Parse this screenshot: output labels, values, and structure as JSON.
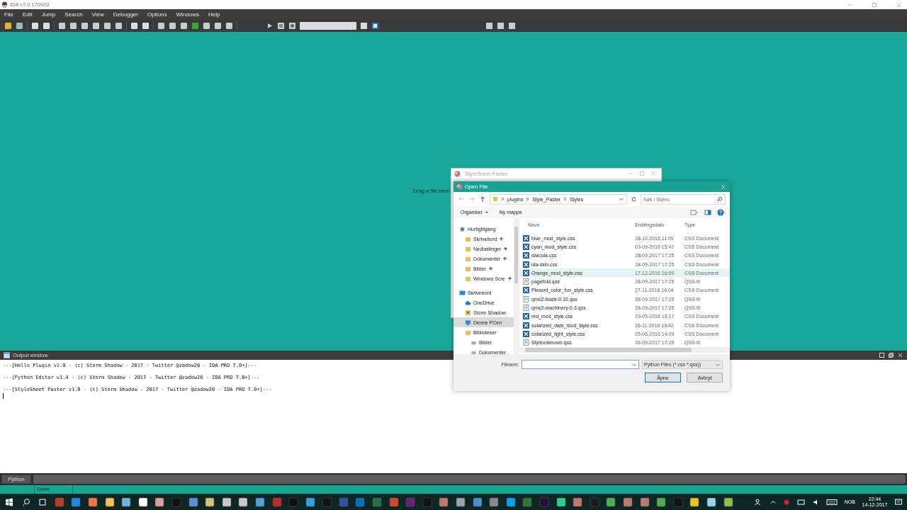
{
  "window": {
    "title": "IDA v7.0.170920"
  },
  "menu": [
    "File",
    "Edit",
    "Jump",
    "Search",
    "View",
    "Debugger",
    "Options",
    "Windows",
    "Help"
  ],
  "canvas": {
    "drop_hint": "Drag a file here"
  },
  "paster_window": {
    "title": "StyleSheet Paster"
  },
  "open_dialog": {
    "title": "Open File",
    "path": [
      "plugins",
      "Style_Paster",
      "Styles"
    ],
    "search": {
      "placeholder": "Søk i Styles"
    },
    "commands": [
      "Organiser",
      "Ny mappe"
    ],
    "nav": [
      {
        "label": "Hurtigtilgang",
        "kind": "star",
        "selected": false,
        "children": [
          {
            "label": "Skrivebord",
            "kind": "folder",
            "pinned": true,
            "selected": false
          },
          {
            "label": "Nedlastinger",
            "kind": "folder",
            "pinned": true,
            "selected": false
          },
          {
            "label": "Dokumenter",
            "kind": "folder",
            "pinned": true,
            "selected": false
          },
          {
            "label": "Bilder",
            "kind": "folder",
            "pinned": true,
            "selected": false
          },
          {
            "label": "Windows Scre",
            "kind": "folder",
            "pinned": true,
            "selected": false
          }
        ]
      },
      {
        "label": "Skrivebord",
        "kind": "desktop",
        "selected": false,
        "children": [
          {
            "label": "OneDrive",
            "kind": "cloud",
            "selected": false
          },
          {
            "label": "Storm Shadow",
            "kind": "user",
            "selected": false
          },
          {
            "label": "Denne PCen",
            "kind": "pc",
            "selected": true
          },
          {
            "label": "Biblioteker",
            "kind": "folder",
            "selected": false,
            "children": [
              {
                "label": "Bilder",
                "kind": "library",
                "selected": false
              },
              {
                "label": "Dokumenter",
                "kind": "library",
                "selected": false
              }
            ]
          }
        ]
      }
    ],
    "columns": [
      "Navn",
      "Endringsdato",
      "Type"
    ],
    "files": [
      {
        "name": "blue_mod_style.css",
        "date": "28-10-2016 11:09",
        "type": "CSS Document",
        "kind": "css",
        "selected": false
      },
      {
        "name": "cyan_mod_style.css",
        "date": "03-09-2016 15:47",
        "type": "CSS Document",
        "kind": "css",
        "selected": false
      },
      {
        "name": "darcula.css",
        "date": "28-09-2017 17:25",
        "type": "CSS Document",
        "kind": "css",
        "selected": false
      },
      {
        "name": "ida-skin.css",
        "date": "28-09-2017 17:25",
        "type": "CSS Document",
        "kind": "css",
        "selected": false
      },
      {
        "name": "Orange_mod_style.css",
        "date": "17-12-2016 16:09",
        "type": "CSS Document",
        "kind": "css",
        "selected": true
      },
      {
        "name": "pagefold.qss",
        "date": "28-09-2017 17:25",
        "type": "QSS-fil",
        "kind": "qss",
        "selected": false
      },
      {
        "name": "Pleasnt_color_fun_style.css",
        "date": "27-11-2016 16:04",
        "type": "CSS Document",
        "kind": "css",
        "selected": false
      },
      {
        "name": "qmc2-black-0.10.qss",
        "date": "28-09-2017 17:25",
        "type": "QSS-fil",
        "kind": "qss",
        "selected": false
      },
      {
        "name": "qmc2-machinery-0.3.qss",
        "date": "28-09-2017 17:25",
        "type": "QSS-fil",
        "kind": "qss",
        "selected": false
      },
      {
        "name": "red_mod_style.css",
        "date": "29-05-2016 13:17",
        "type": "CSS Document",
        "kind": "css",
        "selected": false
      },
      {
        "name": "solarized_dark_mod_style.css",
        "date": "26-11-2016 19:42",
        "type": "CSS Document",
        "kind": "css",
        "selected": false
      },
      {
        "name": "solarized_light_style.css",
        "date": "05-06-2016 14:09",
        "type": "CSS Document",
        "kind": "css",
        "selected": false
      },
      {
        "name": "Styleunknown.qss",
        "date": "28-09-2017 17:25",
        "type": "QSS-fil",
        "kind": "qss",
        "selected": false
      }
    ],
    "filename_label": "Filnavn:",
    "filter": "Python Files (*.css *.qss))",
    "buttons": [
      "Åpne",
      "Avbryt"
    ]
  },
  "output": {
    "title": "Output window",
    "lines": [
      "---[Hello Plugin v1.0 - (c) Storm Shadow - 2017 - Twitter @zadow28 - IDA PRO 7.0+]---",
      "---[Python Editor v1.4 - (c) Storm Shadow - 2017 - Twitter @zadow28 - IDA PRO 7.0+]---",
      "---[StyleSheet Paster v1.0 - (c) Storm Shadow - 2017 - Twitter @zadow28 - IDA PRO 7.0+]---"
    ]
  },
  "python_button": "Python",
  "status": "Down",
  "taskbar": {
    "apps": [
      {
        "color": "#c0392b"
      },
      {
        "color": "#1e88e5"
      },
      {
        "color": "#ff7043"
      },
      {
        "color": "#f2c14e"
      },
      {
        "color": "#6fb4e0"
      },
      {
        "color": "#ffffff"
      },
      {
        "color": "#d9a0a0"
      },
      {
        "color": "#111111"
      },
      {
        "color": "#5b8fd6"
      },
      {
        "color": "#d8c27a"
      },
      {
        "color": "#c8c8c8"
      },
      {
        "color": "#c8c8c8"
      },
      {
        "color": "#4aa3df"
      },
      {
        "color": "#c62828"
      },
      {
        "color": "#111111"
      },
      {
        "color": "#2ca5e0"
      },
      {
        "color": "#111111"
      },
      {
        "color": "#2b579a"
      },
      {
        "color": "#0072c6"
      },
      {
        "color": "#217346"
      },
      {
        "color": "#d24726"
      },
      {
        "color": "#68217a"
      },
      {
        "color": "#111111"
      },
      {
        "color": "#c07a6a"
      },
      {
        "color": "#9aa6b2"
      },
      {
        "color": "#4a90d0"
      },
      {
        "color": "#888888"
      },
      {
        "color": "#00a4ef"
      },
      {
        "color": "#31752f"
      },
      {
        "color": "#2a0b3f"
      },
      {
        "color": "#21d789"
      },
      {
        "color": "#c07a6a"
      },
      {
        "color": "#1a1a1a"
      },
      {
        "color": "#4caf50"
      },
      {
        "color": "#c07a6a"
      },
      {
        "color": "#c07a6a"
      },
      {
        "color": "#4caf50"
      },
      {
        "color": "#111111"
      },
      {
        "color": "#e8c21a"
      },
      {
        "color": "#9ad0f0"
      },
      {
        "color": "#8bc34a"
      }
    ],
    "language": "NOB",
    "time": "22:44",
    "date": "14-12-2017"
  }
}
